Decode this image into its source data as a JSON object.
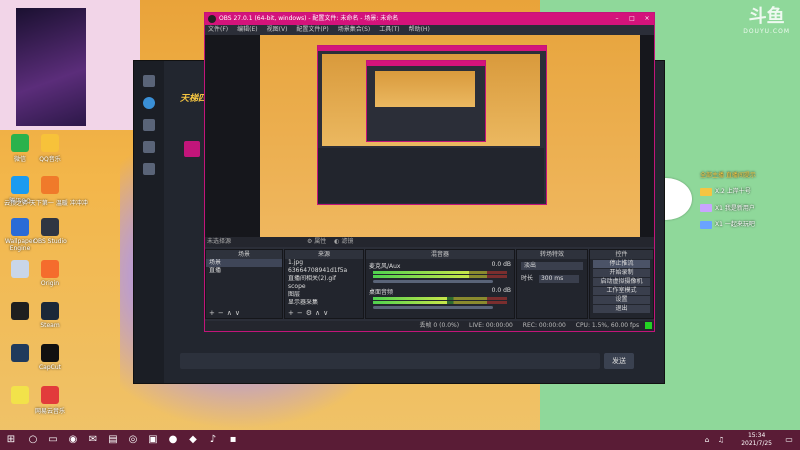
{
  "desktop": {
    "icons": [
      {
        "label": "微信",
        "color": "#2bb24c"
      },
      {
        "label": "QQ音乐",
        "color": "#f7c23a"
      },
      {
        "label": "腾讯QQ",
        "color": "#1b9bf0"
      },
      {
        "label": "",
        "color": "#f07a2a"
      },
      {
        "label": "Wallpaper Engine",
        "color": "#2a6bd6"
      },
      {
        "label": "OBS Studio",
        "color": "#2f3542"
      },
      {
        "label": "",
        "color": "#c9d6e8"
      },
      {
        "label": "Origin",
        "color": "#f56c2d"
      },
      {
        "label": "",
        "color": "#1f1f1f"
      },
      {
        "label": "Steam",
        "color": "#1b2838"
      },
      {
        "label": "",
        "color": "#203a5c"
      },
      {
        "label": "CapCut",
        "color": "#111111"
      },
      {
        "label": "",
        "color": "#f2e24a"
      },
      {
        "label": "网易云音乐",
        "color": "#e23b3b"
      }
    ],
    "note_text": "云顶之弈 天下第一 温暖 冲冲冲"
  },
  "watermark": {
    "logo": "斗鱼",
    "sub": "DOUYU.COM"
  },
  "chat": [
    {
      "text": "全部主播 直播间提示",
      "color": "#f5c542"
    },
    {
      "text": "X.2 上岸十号",
      "color": "#f5c542"
    },
    {
      "text": "X1 我是新用户",
      "color": "#c9a4ff"
    },
    {
      "text": "X1 一起来玩吧",
      "color": "#6aa3ff"
    }
  ],
  "client": {
    "title": "天梯四",
    "send_label": "发送"
  },
  "obs": {
    "title": "OBS 27.0.1 (64-bit, windows) - 配置文件: 未命名 - 场景: 未命名",
    "menu": [
      "文件(F)",
      "编辑(E)",
      "视图(V)",
      "配置文件(P)",
      "场景集合(S)",
      "工具(T)",
      "帮助(H)"
    ],
    "preview_label": "未选择源",
    "controlbar": {
      "props": "属性",
      "filters": "滤镜"
    },
    "scenes": {
      "header": "场景",
      "items": [
        "场景",
        "直播"
      ]
    },
    "sources": {
      "header": "来源",
      "items": [
        "1.jpg",
        "63664708941d1f5a",
        "直播间相关(2).gif",
        "scope",
        "图层",
        "显示器采集"
      ]
    },
    "mixer": {
      "header": "混音器",
      "channels": [
        {
          "name": "麦克风/Aux",
          "db": "0.0 dB",
          "level": 0.72
        },
        {
          "name": "桌面音频",
          "db": "0.0 dB",
          "level": 0.55
        }
      ]
    },
    "transitions": {
      "header": "转场特效",
      "type": "淡出",
      "duration_label": "时长",
      "duration": "300 ms"
    },
    "controls": {
      "header": "控件",
      "buttons": [
        "停止推流",
        "开始录制",
        "启动虚拟摄像机",
        "工作室模式",
        "设置",
        "退出"
      ]
    },
    "status": {
      "dropped": "丢帧 0 (0.0%)",
      "live": "LIVE: 00:00:00",
      "rec": "REC: 00:00:00",
      "cpu": "CPU: 1.5%, 60.00 fps",
      "indicator_color": "#23d323"
    }
  },
  "taskbar": {
    "time": "15:34",
    "date": "2021/7/25",
    "bg": "#5a1c36"
  }
}
